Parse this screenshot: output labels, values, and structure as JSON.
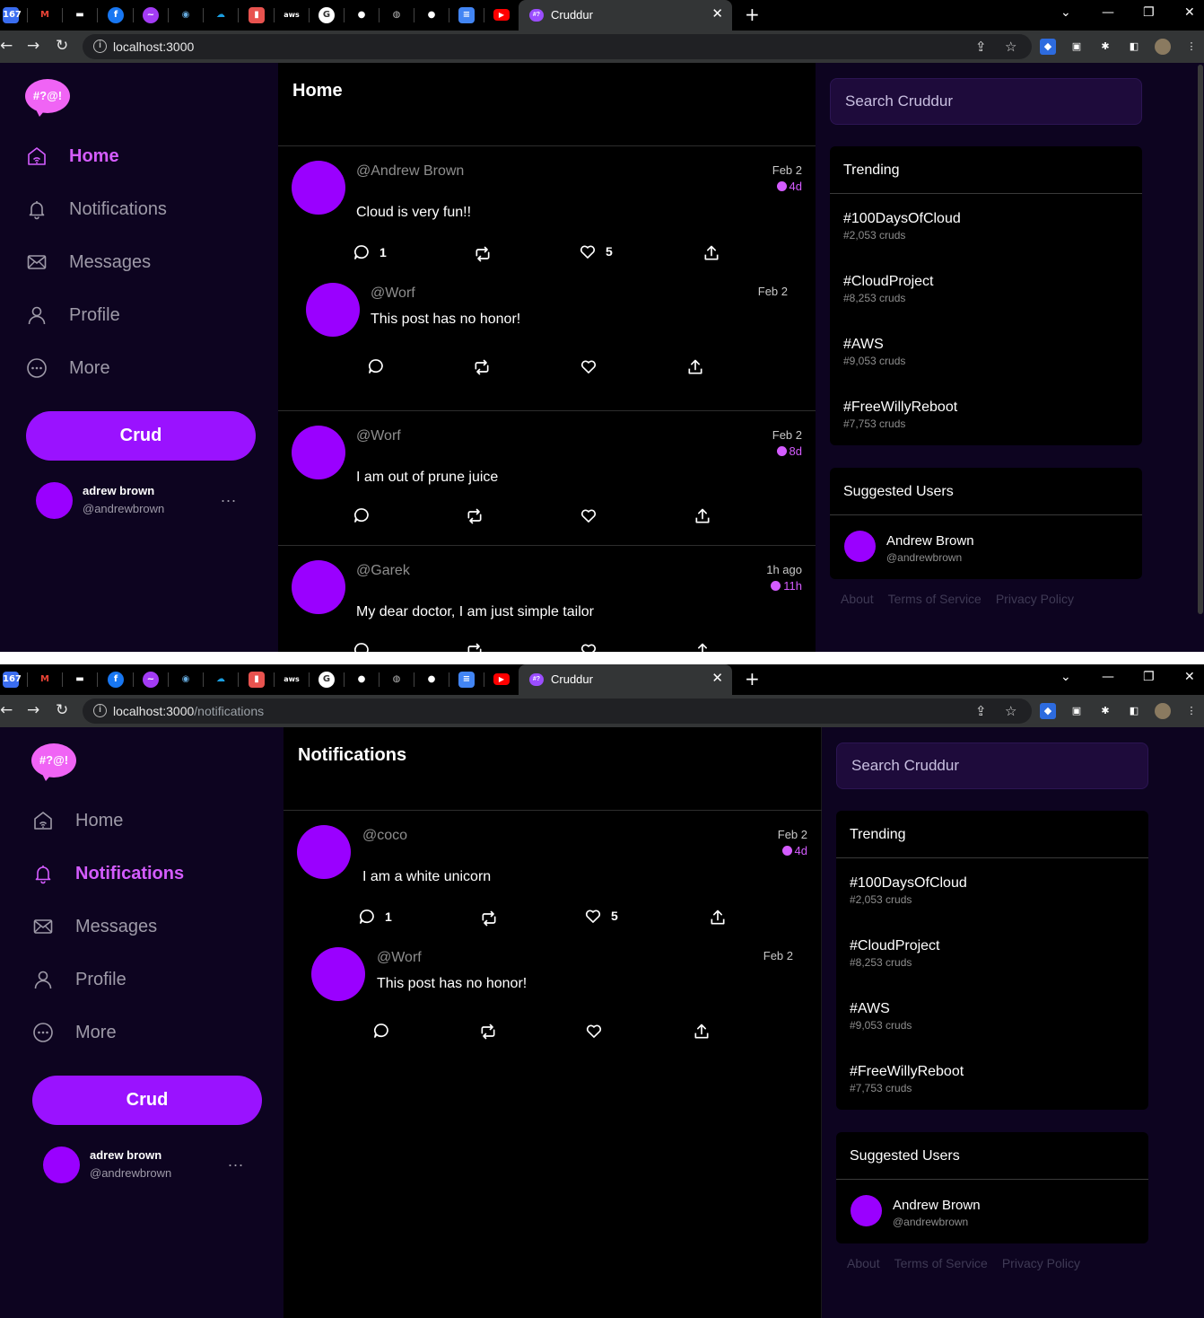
{
  "browser": {
    "tab_title": "Cruddur",
    "tab_close": "✕",
    "new_tab": "+",
    "pinned_badge": "167",
    "win_min": "—",
    "win_max": "❐",
    "win_close": "✕",
    "url_home_host": "localhost:3000",
    "url_home_path": "",
    "url_notif_host": "localhost:3000",
    "url_notif_path": "/notifications"
  },
  "logo_text": "#?@!",
  "menu": {
    "home": "Home",
    "notifications": "Notifications",
    "messages": "Messages",
    "profile": "Profile",
    "more": "More"
  },
  "crud_button": "Crud",
  "user": {
    "name": "adrew brown",
    "handle": "@andrewbrown",
    "more": "..."
  },
  "search_placeholder": "Search Cruddur",
  "trending": {
    "title": "Trending",
    "items": [
      {
        "tag": "#100DaysOfCloud",
        "count": "#2,053 cruds"
      },
      {
        "tag": "#CloudProject",
        "count": "#8,253 cruds"
      },
      {
        "tag": "#AWS",
        "count": "#9,053 cruds"
      },
      {
        "tag": "#FreeWillyReboot",
        "count": "#7,753 cruds"
      }
    ]
  },
  "suggested": {
    "title": "Suggested Users",
    "users": [
      {
        "name": "Andrew Brown",
        "handle": "@andrewbrown"
      }
    ]
  },
  "footer": {
    "about": "About",
    "terms": "Terms of Service",
    "privacy": "Privacy Policy"
  },
  "home_page": {
    "title": "Home",
    "posts": [
      {
        "handle": "@Andrew Brown",
        "date": "Feb 2",
        "expires": "4d",
        "text": "Cloud is very fun!!",
        "reply_count": "1",
        "like_count": "5",
        "reply": {
          "handle": "@Worf",
          "date": "Feb 2",
          "text": "This post has no honor!"
        }
      },
      {
        "handle": "@Worf",
        "date": "Feb 2",
        "expires": "8d",
        "text": "I am out of prune juice"
      },
      {
        "handle": "@Garek",
        "date": "1h ago",
        "expires": "11h",
        "text": "My dear doctor, I am just simple tailor"
      }
    ]
  },
  "notifications_page": {
    "title": "Notifications",
    "posts": [
      {
        "handle": "@coco",
        "date": "Feb 2",
        "expires": "4d",
        "text": "I am a white unicorn",
        "reply_count": "1",
        "like_count": "5",
        "reply": {
          "handle": "@Worf",
          "date": "Feb 2",
          "text": "This post has no honor!"
        }
      }
    ]
  },
  "colors": {
    "accent": "#9a12ff",
    "active": "#d45cff",
    "sidebar_bg": "#0d0420",
    "search_bg": "#1e0b3b"
  }
}
